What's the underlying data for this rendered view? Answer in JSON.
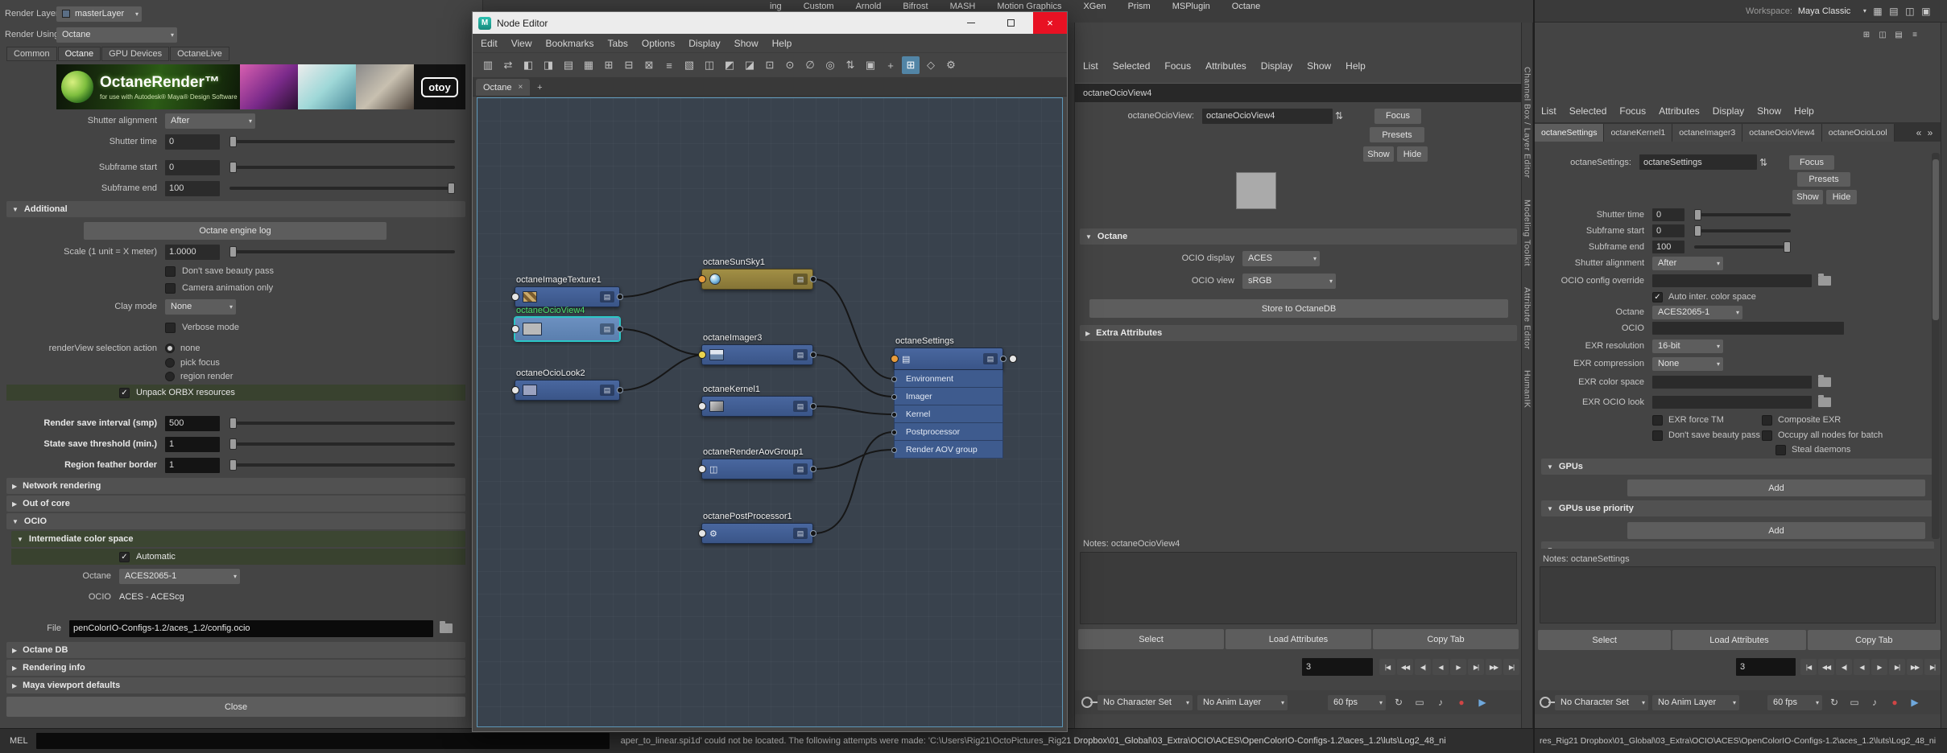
{
  "chrome": {
    "main_menus": [
      "ing",
      "Custom",
      "Arnold",
      "Bifrost",
      "MASH",
      "Motion Graphics",
      "XGen",
      "Prism",
      "MSPlugin",
      "Octane"
    ],
    "ae_menus": [
      "List",
      "Selected",
      "Focus",
      "Attributes",
      "Display",
      "Show",
      "Help"
    ],
    "sidebar_tabs": [
      "Channel Box / Layer Editor",
      "Modeling Toolkit",
      "Attribute Editor",
      "HumanIK"
    ],
    "workspace_label": "Workspace:",
    "workspace_value": "Maya Classic",
    "status_mel": "MEL",
    "status_message": "aper_to_linear.spi1d' could not be located. The following attempts were made:  'C:\\Users\\Rig21\\OctoPictures_Rig21 Dropbox\\01_Global\\03_Extra\\OCIO\\ACES\\OpenColorIO-Configs-1.2\\aces_1.2\\luts\\Log2_48_ni",
    "right_status_path": "res_Rig21 Dropbox\\01_Global\\03_Extra\\OCIO\\ACES\\OpenColorIO-Configs-1.2\\aces_1.2\\luts\\Log2_48_ni"
  },
  "render_settings": {
    "render_layer_label": "Render Layer",
    "render_layer_value": "masterLayer",
    "render_using_label": "Render Using",
    "render_using_value": "Octane",
    "tabs": [
      {
        "label": "Common"
      },
      {
        "label": "Octane",
        "active": true
      },
      {
        "label": "GPU Devices"
      },
      {
        "label": "OctaneLive"
      }
    ],
    "banner_title": "OctaneRender™",
    "banner_subtitle": "for use with Autodesk® Maya® Design Software",
    "banner_brand": "otoy",
    "shutter_alignment_label": "Shutter alignment",
    "shutter_alignment_value": "After",
    "shutter_time_label": "Shutter time",
    "shutter_time_value": "0",
    "subframe_start_label": "Subframe start",
    "subframe_start_value": "0",
    "subframe_end_label": "Subframe end",
    "subframe_end_value": "100",
    "additional_header": "Additional",
    "engine_log_button": "Octane engine log",
    "scale_label": "Scale (1 unit = X meter)",
    "scale_value": "1.0000",
    "dont_save_beauty": "Don't save beauty pass",
    "camera_anim": "Camera animation only",
    "clay_mode_label": "Clay mode",
    "clay_mode_value": "None",
    "verbose": "Verbose mode",
    "renderview_label": "renderView selection action",
    "renderview_options": [
      "none",
      "pick focus",
      "region render"
    ],
    "unpack_orbx": "Unpack ORBX resources",
    "save_interval_label": "Render save interval (smp)",
    "save_interval_value": "500",
    "state_threshold_label": "State save threshold (min.)",
    "state_threshold_value": "1",
    "region_feather_label": "Region feather border",
    "region_feather_value": "1",
    "network_header": "Network rendering",
    "ooc_header": "Out of core",
    "ocio_header": "OCIO",
    "intermediate_header": "Intermediate color space",
    "automatic": "Automatic",
    "octane_cs_label": "Octane",
    "octane_cs_value": "ACES2065-1",
    "ocio_cs_label": "OCIO",
    "ocio_cs_value": "ACES - ACEScg",
    "file_label": "File",
    "file_value": "penColorIO-Configs-1.2/aces_1.2/config.ocio",
    "octanedb_header": "Octane DB",
    "rendering_info_header": "Rendering info",
    "viewport_header": "Maya viewport defaults",
    "close_button": "Close"
  },
  "node_editor": {
    "window_title": "Node Editor",
    "menus": [
      "Edit",
      "View",
      "Bookmarks",
      "Tabs",
      "Options",
      "Display",
      "Show",
      "Help"
    ],
    "toolbar_icons": [
      {
        "g": "▥"
      },
      {
        "g": "⇄"
      },
      {
        "g": "◧"
      },
      {
        "g": "◨"
      },
      {
        "g": "▤"
      },
      {
        "g": "▦"
      },
      {
        "g": "⊞"
      },
      {
        "g": "⊟"
      },
      {
        "g": "⊠"
      },
      {
        "g": "≡"
      },
      {
        "g": "▧"
      },
      {
        "g": "◫"
      },
      {
        "g": "◩"
      },
      {
        "g": "◪"
      },
      {
        "g": "⊡"
      },
      {
        "g": "⊙"
      },
      {
        "g": "∅"
      },
      {
        "g": "◎"
      },
      {
        "g": "⇅"
      },
      {
        "g": "▣"
      },
      {
        "g": "+"
      },
      {
        "g": "⊞",
        "hl": true
      },
      {
        "g": "◇"
      },
      {
        "g": "⚙"
      }
    ],
    "tab_label": "Octane",
    "nodes": {
      "imageTexture": "octaneImageTexture1",
      "sunSky": "octaneSunSky1",
      "ocioView": "octaneOcioView4",
      "imager": "octaneImager3",
      "ocioLook": "octaneOcioLook2",
      "kernel": "octaneKernel1",
      "aovGroup": "octaneRenderAovGroup1",
      "postProcessor": "octanePostProcessor1",
      "settings": "octaneSettings"
    },
    "settings_rows": [
      "Environment",
      "Imager",
      "Kernel",
      "Postprocessor",
      "Render AOV group"
    ]
  },
  "attr_mid": {
    "header_tab": "octaneOcioView4",
    "node_label": "octaneOcioView:",
    "node_value": "octaneOcioView4",
    "focus_button": "Focus",
    "presets_button": "Presets",
    "show_button": "Show",
    "hide_button": "Hide",
    "octane_header": "Octane",
    "ocio_display_label": "OCIO display",
    "ocio_display_value": "ACES",
    "ocio_view_label": "OCIO view",
    "ocio_view_value": "sRGB",
    "store_button": "Store to OctaneDB",
    "extra_header": "Extra Attributes",
    "notes_label": "Notes: octaneOcioView4",
    "select_button": "Select",
    "load_button": "Load Attributes",
    "copy_button": "Copy Tab",
    "frame_value": "3",
    "char_set": "No Character Set",
    "anim_layer": "No Anim Layer",
    "fps": "60 fps"
  },
  "attr_right": {
    "tabs": [
      {
        "label": "octaneSettings",
        "active": true
      },
      {
        "label": "octaneKernel1"
      },
      {
        "label": "octaneImager3"
      },
      {
        "label": "octaneOcioView4"
      },
      {
        "label": "octaneOcioLool"
      }
    ],
    "node_label": "octaneSettings:",
    "node_value": "octaneSettings",
    "focus_button": "Focus",
    "presets_button": "Presets",
    "show_button": "Show",
    "hide_button": "Hide",
    "shutter_time_label": "Shutter time",
    "shutter_time_value": "0",
    "subframe_start_label": "Subframe start",
    "subframe_start_value": "0",
    "subframe_end_label": "Subframe end",
    "subframe_end_value": "100",
    "shutter_alignment_label": "Shutter alignment",
    "shutter_alignment_value": "After",
    "ocio_override_label": "OCIO config override",
    "auto_inter": "Auto inter. color space",
    "octane_label": "Octane",
    "octane_value": "ACES2065-1",
    "ocio_label": "OCIO",
    "exr_resolution_label": "EXR resolution",
    "exr_resolution_value": "16-bit",
    "exr_compression_label": "EXR compression",
    "exr_compression_value": "None",
    "exr_color_space_label": "EXR color space",
    "exr_ocio_look_label": "EXR OCIO look",
    "exr_force_tm": "EXR force TM",
    "composite_exr": "Composite EXR",
    "dont_save_beauty": "Don't save beauty pass",
    "occupy": "Occupy all nodes for batch",
    "steal_daemons": "Steal daemons",
    "gpus_header": "GPUs",
    "gpus_priority_header": "GPUs use priority",
    "add_button": "Add",
    "notes_label": "Notes: octaneSettings",
    "select_button": "Select",
    "load_button": "Load Attributes",
    "copy_button": "Copy Tab",
    "frame_value": "3",
    "char_set": "No Character Set",
    "anim_layer": "No Anim Layer",
    "fps": "60 fps"
  },
  "transport": [
    "|◀",
    "◀◀",
    "◀|",
    "◀",
    "▶",
    "▶|",
    "▶▶",
    "▶|"
  ],
  "colors": {
    "node_blue": "#3f5c8c",
    "node_selected": "#6287b8",
    "node_sun": "#94823d",
    "selected_outline": "#2bc6c6",
    "label_green": "#4ee06e",
    "highlight_row": "#3c4632",
    "close_red": "#e81123",
    "toolbar_active": "#5285a6"
  }
}
